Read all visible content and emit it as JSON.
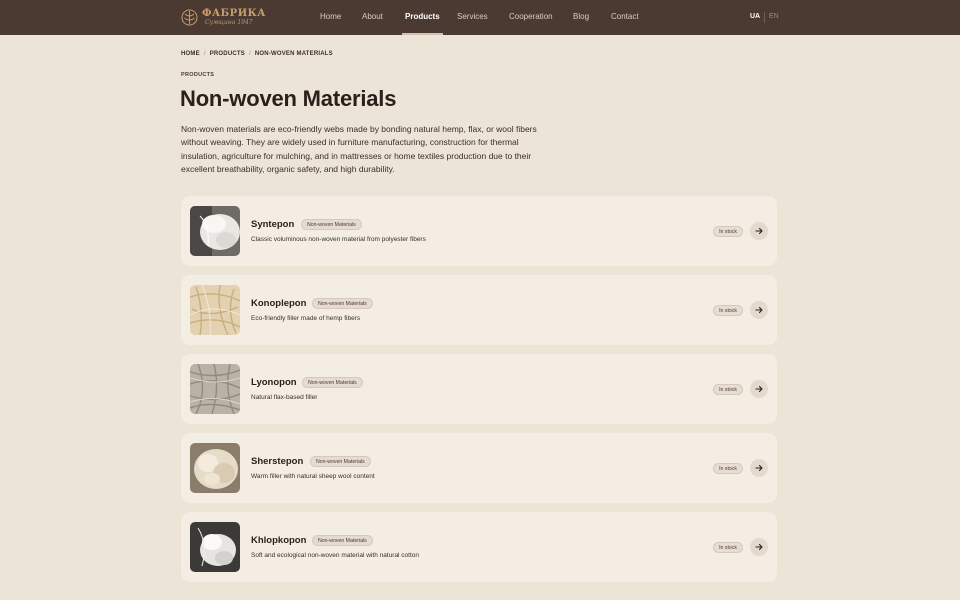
{
  "header": {
    "logo_title": "ФАБРИКА",
    "logo_subtitle": "Сумщина 1947",
    "nav": [
      "Home",
      "About",
      "Products",
      "Services",
      "Cooperation",
      "Blog",
      "Contact"
    ],
    "active_nav": "Products",
    "languages": [
      "UA",
      "EN"
    ],
    "active_language": "UA"
  },
  "breadcrumb": [
    "HOME",
    "PRODUCTS",
    "NON-WOVEN MATERIALS"
  ],
  "eyebrow": "PRODUCTS",
  "title": "Non-woven Materials",
  "intro": "Non-woven materials are eco-friendly webs made by bonding natural hemp, flax, or wool fibers without weaving. They are widely used in furniture manufacturing, construction for thermal insulation, agriculture for mulching, and in mattresses or home textiles production due to their excellent breathability, organic safety, and high durability.",
  "products": [
    {
      "name": "Syntepon",
      "tag": "Non-woven Materials",
      "description": "Classic voluminous non-woven material from polyester fibers",
      "stock": "In stock"
    },
    {
      "name": "Konoplepon",
      "tag": "Non-woven Materials",
      "description": "Eco-friendly filler made of hemp fibers",
      "stock": "In stock"
    },
    {
      "name": "Lyonopon",
      "tag": "Non-woven Materials",
      "description": "Natural flax-based filler",
      "stock": "In stock"
    },
    {
      "name": "Sherstepon",
      "tag": "Non-woven Materials",
      "description": "Warm filler with natural sheep wool content",
      "stock": "In stock"
    },
    {
      "name": "Khlopkopon",
      "tag": "Non-woven Materials",
      "description": "Soft and ecological non-woven material with natural cotton",
      "stock": "In stock"
    }
  ],
  "colors": {
    "header_bg": "#4a3a32",
    "page_bg": "#ede4d8",
    "card_bg": "#f4ede4",
    "logo_gold": "#c79e6c"
  }
}
